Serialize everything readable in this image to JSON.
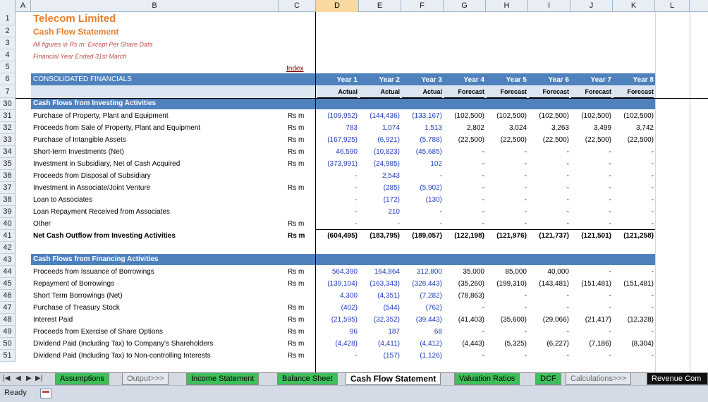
{
  "columns": [
    "A",
    "B",
    "C",
    "D",
    "E",
    "F",
    "G",
    "H",
    "I",
    "J",
    "K",
    "L"
  ],
  "selected_column": "D",
  "rows": [
    "1",
    "2",
    "3",
    "4",
    "5",
    "6",
    "7",
    "30",
    "31",
    "32",
    "33",
    "34",
    "35",
    "36",
    "37",
    "38",
    "39",
    "40",
    "41",
    "42",
    "43",
    "44",
    "45",
    "46",
    "47",
    "48",
    "49",
    "50",
    "51"
  ],
  "header": {
    "company": "Telecom Limited",
    "statement": "Cash Flow Statement",
    "note1": "All figures in Rs m; Except Per Share Data",
    "note2": "Financial Year Ended 31st March",
    "index_link": "Index",
    "consolidated": "CONSOLIDATED FINANCIALS",
    "years": [
      "Year 1",
      "Year 2",
      "Year 3",
      "Year 4",
      "Year 5",
      "Year 6",
      "Year 7",
      "Year 8"
    ],
    "types": [
      "Actual",
      "Actual",
      "Actual",
      "Forecast",
      "Forecast",
      "Forecast",
      "Forecast",
      "Forecast"
    ]
  },
  "investing": {
    "title": "Cash Flows from Investing Activities",
    "rows": [
      {
        "label": "Purchase of Property, Plant and Equipment",
        "unit": "Rs m",
        "v": [
          "(109,952)",
          "(144,436)",
          "(133,167)",
          "(102,500)",
          "(102,500)",
          "(102,500)",
          "(102,500)",
          "(102,500)"
        ]
      },
      {
        "label": "Proceeds from Sale of Property, Plant and Equipment",
        "unit": "Rs m",
        "v": [
          "783",
          "1,074",
          "1,513",
          "2,802",
          "3,024",
          "3,263",
          "3,499",
          "3,742"
        ]
      },
      {
        "label": "Purchase of Intangible Assets",
        "unit": "Rs m",
        "v": [
          "(167,925)",
          "(6,921)",
          "(5,788)",
          "(22,500)",
          "(22,500)",
          "(22,500)",
          "(22,500)",
          "(22,500)"
        ]
      },
      {
        "label": "Short-term Investments (Net)",
        "unit": "Rs m",
        "v": [
          "46,590",
          "(10,823)",
          "(45,685)",
          "-",
          "-",
          "-",
          "-",
          "-"
        ]
      },
      {
        "label": "Investment in Subsidiary, Net of Cash Acquired",
        "unit": "Rs m",
        "v": [
          "(373,991)",
          "(24,985)",
          "102",
          "-",
          "-",
          "-",
          "-",
          "-"
        ]
      },
      {
        "label": "Proceeds from Disposal of Subsidiary",
        "unit": "",
        "v": [
          "-",
          "2,543",
          "-",
          "-",
          "-",
          "-",
          "-",
          "-"
        ]
      },
      {
        "label": "Investment in Associate/Joint Venture",
        "unit": "Rs m",
        "v": [
          "-",
          "(285)",
          "(5,902)",
          "-",
          "-",
          "-",
          "-",
          "-"
        ]
      },
      {
        "label": "Loan to Associates",
        "unit": "",
        "v": [
          "-",
          "(172)",
          "(130)",
          "-",
          "-",
          "-",
          "-",
          "-"
        ]
      },
      {
        "label": "Loan Repayment Received from Associates",
        "unit": "",
        "v": [
          "-",
          "210",
          "-",
          "-",
          "-",
          "-",
          "-",
          "-"
        ]
      },
      {
        "label": "Other",
        "unit": "Rs m",
        "v": [
          "-",
          "-",
          "-",
          "-",
          "-",
          "-",
          "-",
          "-"
        ]
      }
    ],
    "total": {
      "label": "Net Cash Outflow from Investing Activities",
      "unit": "Rs m",
      "v": [
        "(604,495)",
        "(183,795)",
        "(189,057)",
        "(122,198)",
        "(121,976)",
        "(121,737)",
        "(121,501)",
        "(121,258)"
      ]
    }
  },
  "financing": {
    "title": "Cash Flows from Financing Activities",
    "rows": [
      {
        "label": "Proceeds from Issuance of Borrowings",
        "unit": "Rs m",
        "v": [
          "564,390",
          "164,864",
          "312,800",
          "35,000",
          "85,000",
          "40,000",
          "-",
          "-"
        ]
      },
      {
        "label": "Repayment of Borrowings",
        "unit": "Rs m",
        "v": [
          "(139,104)",
          "(163,343)",
          "(328,443)",
          "(35,260)",
          "(199,310)",
          "(143,481)",
          "(151,481)",
          "(151,481)"
        ]
      },
      {
        "label": "Short Term Borrowings (Net)",
        "unit": "",
        "v": [
          "4,300",
          "(4,351)",
          "(7,282)",
          "(78,863)",
          "-",
          "-",
          "-",
          "-"
        ]
      },
      {
        "label": "Purchase of Treasury Stock",
        "unit": "Rs m",
        "v": [
          "(402)",
          "(544)",
          "(762)",
          "-",
          "-",
          "-",
          "-",
          "-"
        ]
      },
      {
        "label": "Interest Paid",
        "unit": "Rs m",
        "v": [
          "(21,595)",
          "(32,352)",
          "(39,443)",
          "(41,403)",
          "(35,600)",
          "(29,066)",
          "(21,417)",
          "(12,328)"
        ]
      },
      {
        "label": "Proceeds from Exercise of Share Options",
        "unit": "Rs m",
        "v": [
          "96",
          "187",
          "68",
          "-",
          "-",
          "-",
          "-",
          "-"
        ]
      },
      {
        "label": "Dividend Paid (Including Tax) to Company's Shareholders",
        "unit": "Rs m",
        "v": [
          "(4,428)",
          "(4,411)",
          "(4,412)",
          "(4,443)",
          "(5,325)",
          "(6,227)",
          "(7,186)",
          "(8,304)"
        ]
      },
      {
        "label": "Dividend Paid (Including Tax) to Non-controlling Interests",
        "unit": "Rs m",
        "v": [
          "-",
          "(157)",
          "(1,126)",
          "-",
          "-",
          "-",
          "-",
          "-"
        ]
      }
    ]
  },
  "tabs": [
    "Assumptions",
    "Output>>>",
    "Income Statement",
    "Balance Sheet",
    "Cash Flow Statement",
    "Valuation Ratios",
    "DCF",
    "Calculations>>>",
    "Revenue Com"
  ],
  "status": "Ready"
}
